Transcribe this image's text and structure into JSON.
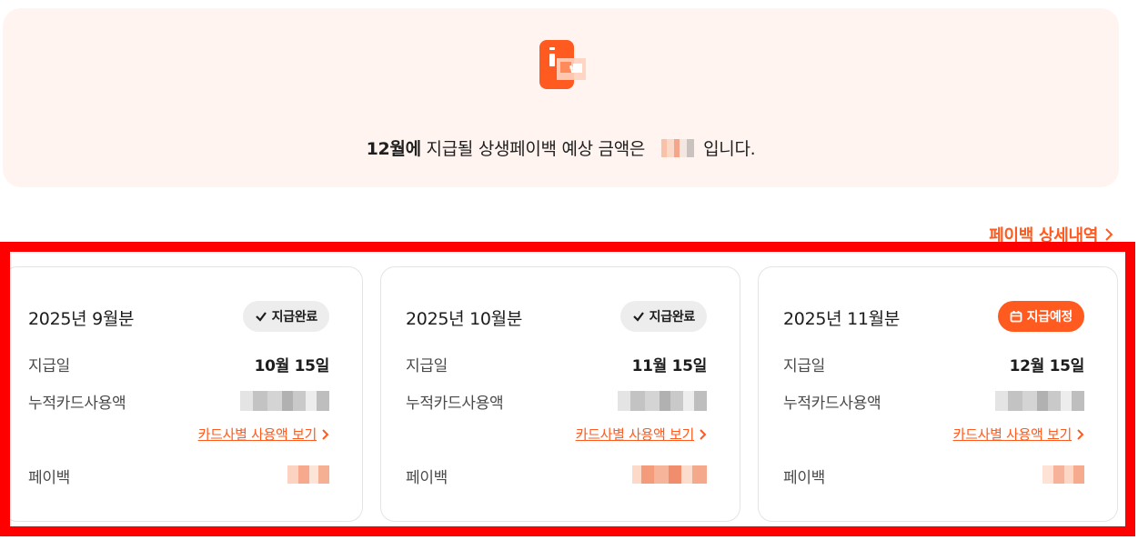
{
  "summary": {
    "month_bold": "12월에",
    "text_before": " 지급될 상생페이백 예상 금액은",
    "text_after": "입니다.",
    "icon": "phone-won-icon"
  },
  "detail_link": {
    "label": "페이백 상세내역"
  },
  "cards": [
    {
      "month": "2025년 9월분",
      "status": "지급완료",
      "status_type": "done",
      "payday_label": "지급일",
      "payday_value": "10월 15일",
      "usage_label": "누적카드사용액",
      "card_link": "카드사별 사용액 보기",
      "payback_label": "페이백"
    },
    {
      "month": "2025년 10월분",
      "status": "지급완료",
      "status_type": "done",
      "payday_label": "지급일",
      "payday_value": "11월 15일",
      "usage_label": "누적카드사용액",
      "card_link": "카드사별 사용액 보기",
      "payback_label": "페이백"
    },
    {
      "month": "2025년 11월분",
      "status": "지급예정",
      "status_type": "planned",
      "payday_label": "지급일",
      "payday_value": "12월 15일",
      "usage_label": "누적카드사용액",
      "card_link": "카드사별 사용액 보기",
      "payback_label": "페이백"
    }
  ],
  "colors": {
    "accent": "#ff5a1f",
    "summary_bg": "#fff4ef",
    "highlight": "#ff0000"
  }
}
